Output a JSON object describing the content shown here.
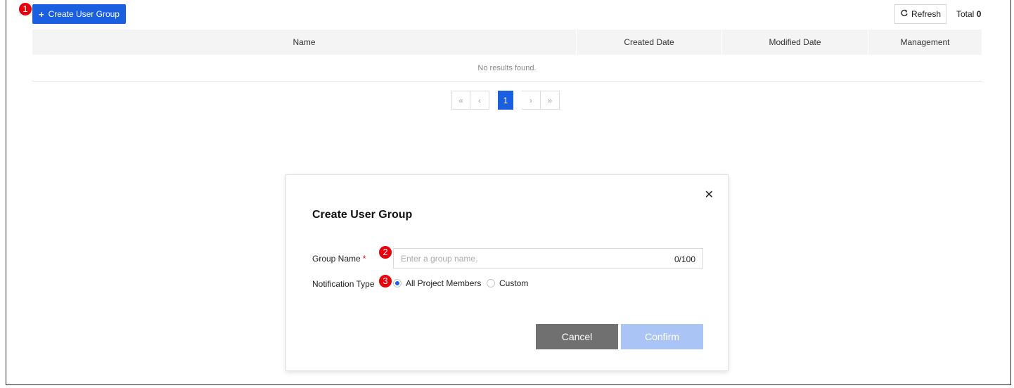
{
  "toolbar": {
    "create_label": "Create User Group",
    "refresh_label": "Refresh",
    "total_label": "Total",
    "total_count": "0"
  },
  "table": {
    "columns": [
      "Name",
      "Created Date",
      "Modified Date",
      "Management"
    ],
    "empty_text": "No results found."
  },
  "pagination": {
    "first": "«",
    "prev": "‹",
    "current_page": "1",
    "next": "›",
    "last": "»"
  },
  "modal": {
    "title": "Create User Group",
    "close_glyph": "✕",
    "group_name_label": "Group Name",
    "required_mark": "*",
    "group_name_placeholder": "Enter a group name.",
    "group_name_value": "",
    "group_name_counter": "0/100",
    "notification_label": "Notification Type",
    "options": [
      "All Project Members",
      "Custom"
    ],
    "selected_option": "All Project Members",
    "cancel_label": "Cancel",
    "confirm_label": "Confirm"
  },
  "callouts": [
    "1",
    "2",
    "3"
  ],
  "colors": {
    "accent": "#1a5fe0",
    "callout": "#e8000b",
    "cancel": "#707070",
    "confirm_disabled": "#a9c4f5"
  },
  "icons": [
    "plus-icon",
    "refresh-icon",
    "close-icon"
  ]
}
